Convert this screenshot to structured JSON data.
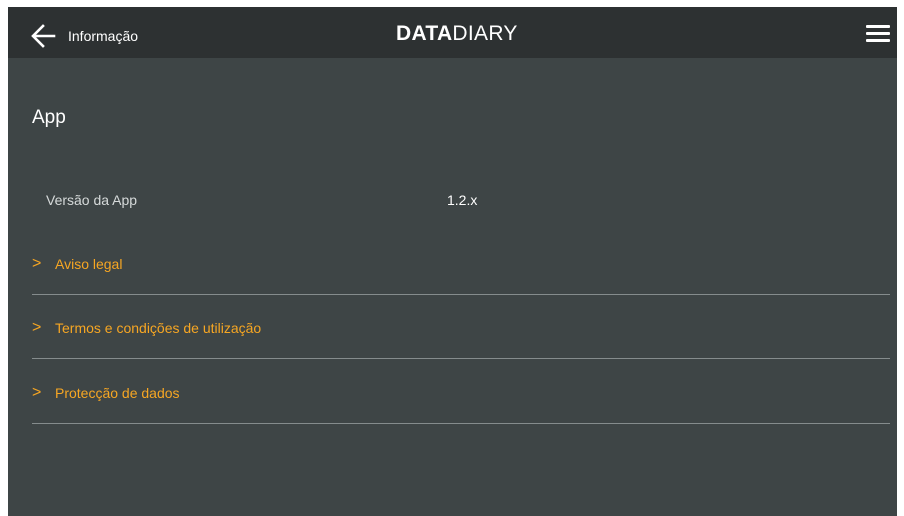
{
  "header": {
    "back_label": "Informação",
    "logo_bold": "DATA",
    "logo_light": "DIARY",
    "back_icon": "arrow-left-icon",
    "menu_icon": "hamburger-menu-icon"
  },
  "section": {
    "title": "App"
  },
  "version": {
    "label": "Versão da App",
    "value": "1.2.x"
  },
  "links": [
    {
      "chevron": ">",
      "label": "Aviso legal"
    },
    {
      "chevron": ">",
      "label": "Termos e condições de utilização"
    },
    {
      "chevron": ">",
      "label": "Protecção de dados"
    }
  ],
  "colors": {
    "background": "#3e4546",
    "topbar": "#2d3132",
    "accent": "#f6a623",
    "text": "#ffffff",
    "divider": "#858c8d"
  }
}
